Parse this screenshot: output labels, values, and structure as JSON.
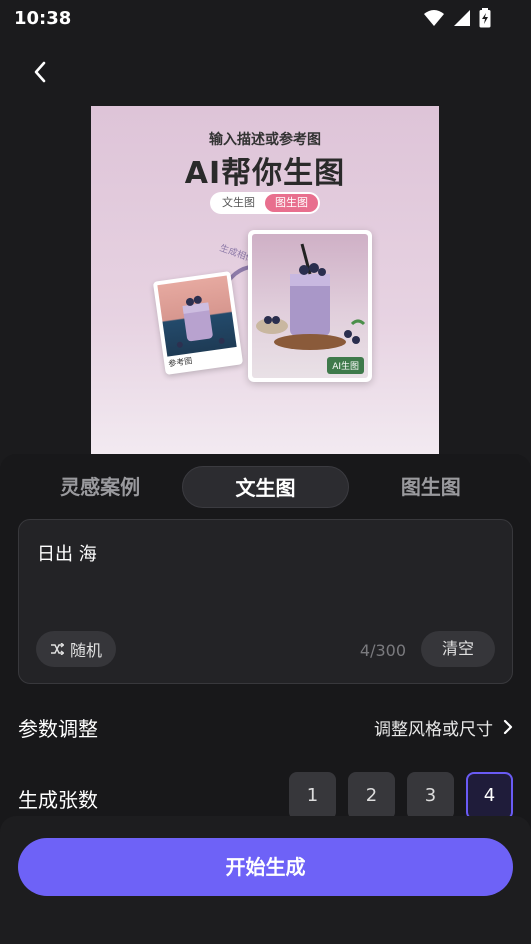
{
  "status": {
    "time": "10:38"
  },
  "preview": {
    "subtitle": "输入描述或参考图",
    "title": "AI帮你生图",
    "toggle_left": "文生图",
    "toggle_right": "图生图",
    "arrow_text": "生成相似图",
    "ref_label": "参考图",
    "ai_badge": "AI生图"
  },
  "tabs": [
    {
      "label": "灵感案例",
      "active": false
    },
    {
      "label": "文生图",
      "active": true
    },
    {
      "label": "图生图",
      "active": false
    }
  ],
  "prompt": {
    "text": "日出 海",
    "random_label": "随机",
    "char_count": "4/300",
    "clear_label": "清空"
  },
  "params": {
    "label": "参数调整",
    "link_label": "调整风格或尺寸"
  },
  "count": {
    "label": "生成张数",
    "options": [
      "1",
      "2",
      "3",
      "4"
    ],
    "selected": "4"
  },
  "footer": {
    "start_label": "开始生成"
  },
  "colors": {
    "accent": "#6e62f7",
    "background": "#1b1b1d",
    "badge": "#e86f8e"
  }
}
